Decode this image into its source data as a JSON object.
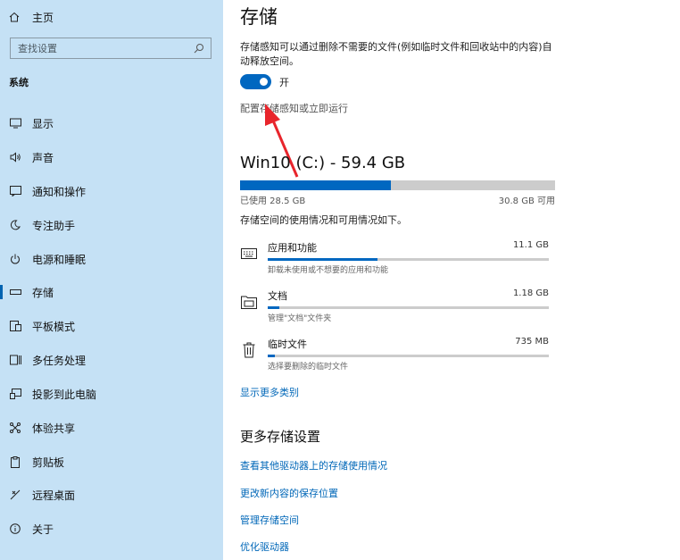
{
  "sidebar": {
    "home_label": "主页",
    "search_placeholder": "查找设置",
    "section_label": "系统",
    "items": [
      {
        "label": "显示",
        "icon": "monitor-icon"
      },
      {
        "label": "声音",
        "icon": "speaker-icon"
      },
      {
        "label": "通知和操作",
        "icon": "notification-icon"
      },
      {
        "label": "专注助手",
        "icon": "moon-icon"
      },
      {
        "label": "电源和睡眠",
        "icon": "power-icon"
      },
      {
        "label": "存储",
        "icon": "storage-icon",
        "active": true
      },
      {
        "label": "平板模式",
        "icon": "tablet-icon"
      },
      {
        "label": "多任务处理",
        "icon": "multitask-icon"
      },
      {
        "label": "投影到此电脑",
        "icon": "project-icon"
      },
      {
        "label": "体验共享",
        "icon": "share-icon"
      },
      {
        "label": "剪贴板",
        "icon": "clipboard-icon"
      },
      {
        "label": "远程桌面",
        "icon": "remote-desktop-icon"
      },
      {
        "label": "关于",
        "icon": "info-icon"
      }
    ]
  },
  "main": {
    "title": "存储",
    "storage_sense_desc": "存储感知可以通过删除不需要的文件(例如临时文件和回收站中的内容)自动释放空间。",
    "toggle": {
      "on": true,
      "label": "开"
    },
    "config_link": "配置存储感知或立即运行",
    "drive": {
      "title": "Win10 (C:) - 59.4 GB",
      "used_label": "已使用 28.5 GB",
      "free_label": "30.8 GB 可用",
      "used_fraction": 0.48,
      "note": "存储空间的使用情况和可用情况如下。"
    },
    "categories": [
      {
        "name": "应用和功能",
        "size": "11.1 GB",
        "sub": "卸载未使用或不想要的应用和功能",
        "fraction": 0.39,
        "icon": "keyboard-icon"
      },
      {
        "name": "文档",
        "size": "1.18 GB",
        "sub": "管理\"文档\"文件夹",
        "fraction": 0.04,
        "icon": "folder-icon"
      },
      {
        "name": "临时文件",
        "size": "735 MB",
        "sub": "选择要删除的临时文件",
        "fraction": 0.025,
        "icon": "trash-icon"
      }
    ],
    "more_categories": "显示更多类别",
    "more_settings_title": "更多存储设置",
    "links": [
      "查看其他驱动器上的存储使用情况",
      "更改新内容的保存位置",
      "管理存储空间",
      "优化驱动器"
    ]
  },
  "colors": {
    "sidebar_bg": "#c5e1f5",
    "accent": "#0067c0",
    "link": "#0067b8",
    "annotation_arrow": "#e8252c"
  }
}
